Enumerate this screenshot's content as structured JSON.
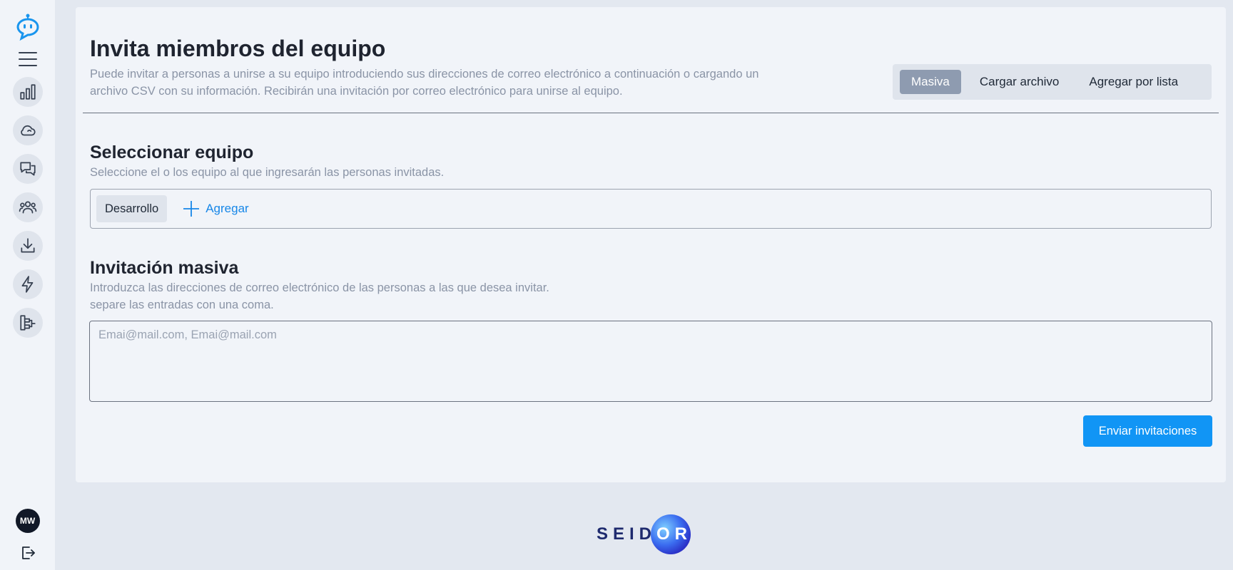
{
  "header": {
    "title": "Invita miembros del equipo",
    "description": "Puede invitar a personas a unirse a su equipo introduciendo sus direcciones de correo electrónico a continuación o cargando un archivo CSV con su información. Recibirán una invitación por correo electrónico para unirse al equipo."
  },
  "tabs": [
    {
      "label": "Masiva",
      "active": true
    },
    {
      "label": "Cargar archivo",
      "active": false
    },
    {
      "label": "Agregar por lista",
      "active": false
    }
  ],
  "team_section": {
    "title": "Seleccionar equipo",
    "description": "Seleccione el o los equipo al que ingresarán las personas invitadas.",
    "selected_team": "Desarrollo",
    "add_label": "Agregar"
  },
  "bulk_section": {
    "title": "Invitación masiva",
    "description_line1": "Introduzca las direcciones de correo electrónico de las personas a las que desea invitar.",
    "description_line2": "separe las entradas con una coma.",
    "email_placeholder": "Emai@mail.com, Emai@mail.com",
    "email_value": ""
  },
  "send_button": "Enviar invitaciones",
  "user": {
    "initials": "MW"
  },
  "sidebar_icons": [
    "bot-icon",
    "menu-icon",
    "chart-icon",
    "cloud-icon",
    "chat-icon",
    "users-icon",
    "download-icon",
    "lightning-icon",
    "flow-icon",
    "logout-icon"
  ],
  "brand": {
    "left": "SEID",
    "right": "OR"
  },
  "colors": {
    "accent": "#1195f5",
    "active_tab": "#8e9bb0",
    "background": "#e3e8f0",
    "card": "#f1f4f9"
  }
}
